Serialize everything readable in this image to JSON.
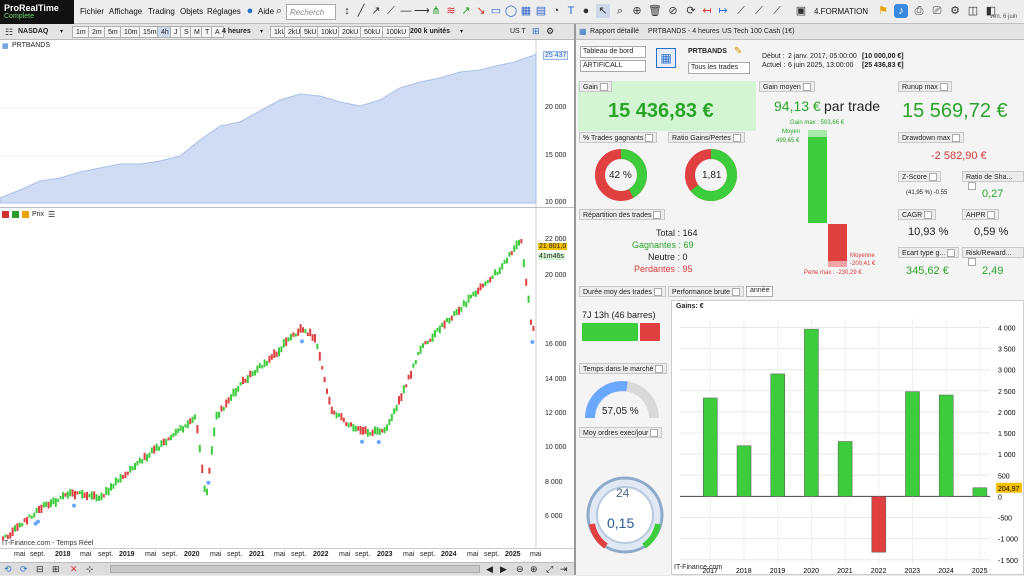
{
  "app": {
    "name_line1": "ProRealTime",
    "name_line2": "Complete"
  },
  "menu": [
    "Fichier",
    "Affichage",
    "Trading",
    "Objets",
    "Réglages",
    "Aide"
  ],
  "search": {
    "placeholder": "Recherch"
  },
  "workspace": {
    "label": "4.FORMATION"
  },
  "date_right": "ven. 6 juin",
  "instrument": "NASDAQ",
  "timeframes": [
    "1m",
    "2m",
    "5m",
    "10m",
    "15m",
    "4h",
    "J",
    "S",
    "M",
    "T",
    "A"
  ],
  "period": "4 heures",
  "tick_buttons": [
    "1U",
    "2U",
    "5U",
    "10U",
    "20U",
    "50U",
    "100U",
    "1kU",
    "2kU",
    "5kU",
    "10kU",
    "20kU",
    "50kU",
    "100kU"
  ],
  "units": "200 k unités",
  "contract": "US T",
  "equity_chart": {
    "title": "PRTBANDS",
    "last_value": "25 437",
    "y_labels": [
      "20 000",
      "15 000",
      "10 000"
    ]
  },
  "price_chart": {
    "legend": "Prix",
    "last_price": "21 801,0",
    "timer": "41m46s",
    "y_labels": [
      "22 000",
      "20 000",
      "18 000",
      "16 000",
      "14 000",
      "12 000",
      "10 000",
      "8 000",
      "6 000"
    ],
    "watermark": "IT-Finance.com - Temps Réel"
  },
  "x_axis": [
    "2018",
    "mai",
    "sept.",
    "2019",
    "mai",
    "sept.",
    "2020",
    "mai",
    "sept.",
    "2021",
    "mai",
    "sept.",
    "2022",
    "mai",
    "sept.",
    "2023",
    "mai",
    "sept.",
    "2024",
    "mai",
    "sept.",
    "2025",
    "mai"
  ],
  "report": {
    "tab_label": "Rapport détaillé",
    "tab_name": "PRTBANDS - 4 heures",
    "tab_instrument": "US Tech 100 Cash (1€)",
    "dashboard": "Tableau de bord",
    "mode": "ARTIFICALL",
    "system": "PRTBANDS",
    "trades_filter": "Tous les trades",
    "debut_label": "Début :",
    "debut_date": "2 janv. 2017, 05:00:00",
    "debut_value": "[10 000,00 €]",
    "actuel_label": "Actuel :",
    "actuel_date": "6 juin 2025, 13:00:00",
    "actuel_value": "[25 436,83 €]",
    "gain_label": "Gain",
    "gain_value": "15 436,83 €",
    "gain_moyen_label": "Gain moyen",
    "gain_moyen_value": "94,13 €",
    "par_trade": "par trade",
    "runup_label": "Runup max",
    "runup_value": "15 569,72 €",
    "drawdown_label": "Drawdown max",
    "drawdown_value": "-2 582,90 €",
    "pct_gagnants_label": "% Trades gagnants",
    "pct_gagnants_value": "42 %",
    "ratio_label": "Ratio Gains/Pertes",
    "ratio_value": "1,81",
    "gain_max": "Gain max : 503,66 €",
    "moyen_label": "Moyen",
    "moyen_value": "499,65 €",
    "moyenne_label": "Moyenne",
    "moyenne_value": "-200,41 €",
    "perte_max": "Perte max : -230,29 €",
    "zscore_label": "Z-Score",
    "zscore_detail": "(41,95 %)  -0.55",
    "sharpe_label": "Ratio de Sha...",
    "sharpe_value": "0,27",
    "cagr_label": "CAGR",
    "cagr_value": "10,93 %",
    "ahpr_label": "AHPR",
    "ahpr_value": "0,59 %",
    "ecart_label": "Ecart type g...",
    "ecart_value": "345,62 €",
    "risk_label": "Risk/Reward...",
    "risk_value": "2,49",
    "repartition_label": "Répartition des trades",
    "total_line": "Total : 164",
    "gagnantes_line": "Gagnantes : 69",
    "neutre_line": "Neutre : 0",
    "perdantes_line": "Perdantes : 95",
    "duree_label": "Durée moy des trades",
    "duree_value": "7J 13h (46 barres)",
    "temps_label": "Temps dans le marché",
    "temps_value": "57,05 %",
    "ordres_label": "Moy ordres exec/jour",
    "gauge_top": "24",
    "gauge_value": "0,15",
    "perf_label": "Performance brute",
    "perf_period": "année",
    "gains_label": "Gains: €",
    "watermark": "IT-Finance.com",
    "colors": {
      "green": "#3ccc3c",
      "red": "#e04040",
      "blue": "#6aa7ff"
    }
  },
  "chart_data": {
    "type": "bar",
    "categories": [
      "2017",
      "2018",
      "2019",
      "2020",
      "2021",
      "2022",
      "2023",
      "2024",
      "2025"
    ],
    "values": [
      2330,
      1200,
      2900,
      3960,
      1300,
      -1320,
      2480,
      2400,
      205
    ],
    "last_label": "204,97",
    "ylim": [
      -1600,
      4200
    ],
    "y_ticks": [
      "4 000",
      "3 500",
      "3 000",
      "2 500",
      "2 000",
      "1 500",
      "1 000",
      "500",
      "0",
      "-500",
      "-1 000",
      "-1 500"
    ]
  }
}
